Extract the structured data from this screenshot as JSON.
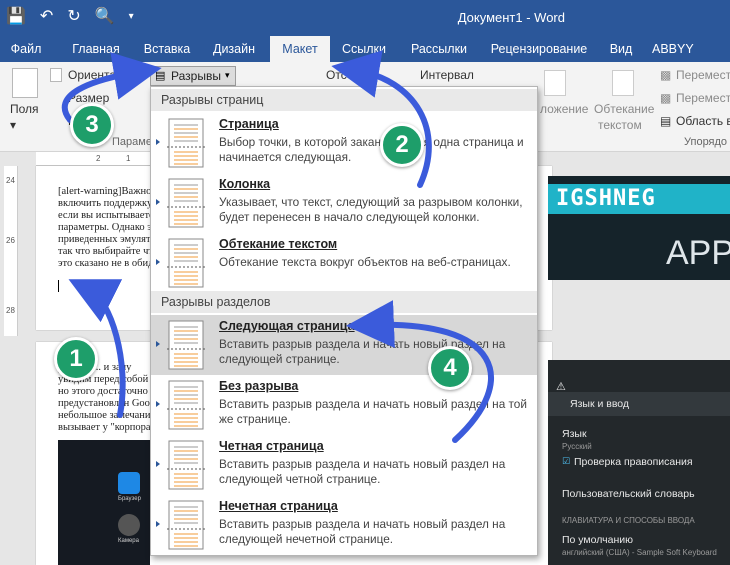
{
  "window": {
    "title": "Документ1 - Word"
  },
  "tabs": [
    "Файл",
    "Главная",
    "Вставка",
    "Дизайн",
    "Макет",
    "Ссылки",
    "Рассылки",
    "Рецензирование",
    "Вид",
    "ABBYY FineRe"
  ],
  "ribbon": {
    "fields_label": "Поля",
    "orientation_label": "Ориентация",
    "size_label": "Размер",
    "columns_label": "Ко",
    "breaks_label": "Разрывы",
    "indent_label": "Отс",
    "interval_label": "Интервал",
    "page_setup_group": "Параметры",
    "position_label": "ложение",
    "wrap_text_label": "Обтекание",
    "wrap_text_label2": "текстом",
    "move_forward": "Перемест",
    "move_backward": "Перемест",
    "selection_pane": "Область в",
    "arrange_group": "Упорядо"
  },
  "ruler": {
    "h_marks": [
      "2",
      "1"
    ],
    "v_marks": [
      "24",
      "26",
      "28",
      "2"
    ]
  },
  "document": {
    "page1_lines": [
      "[alert-warning]Важное",
      "включить поддержку в",
      "если вы испытываете",
      "параметры. Однако эт",
      "приведенных эмулято",
      "так что выбирайте что",
      "это сказано не в обиду"
    ],
    "page2_lines": [
      "установ... и запу",
      "увидим перед собой",
      "но этого достаточно д",
      "предустановлен Googl",
      "небольшое замечание",
      "вызывает у \"корпорац"
    ]
  },
  "images": {
    "banner_title": "IGSHNEG",
    "banner_sub": "APP",
    "emulator_labels": [
      "Браузер",
      "Камера"
    ],
    "settings_header": "Язык и ввод",
    "settings_lang": "Язык",
    "settings_lang_value": "Русский",
    "settings_spell": "Проверка правописания",
    "settings_dict": "Пользовательский словарь",
    "settings_section": "КЛАВИАТУРА И СПОСОБЫ ВВОДА",
    "settings_default": "По умолчанию",
    "settings_default_value": "английский (США) - Sample Soft Keyboard"
  },
  "dropdown": {
    "section_page_breaks": "Разрывы страниц",
    "section_section_breaks": "Разрывы разделов",
    "items": [
      {
        "title": "Страница",
        "desc": "Выбор точки, в которой заканчивается одна страница и начинается следующая."
      },
      {
        "title": "Колонка",
        "desc": "Указывает, что текст, следующий за разрывом колонки, будет перенесен в начало следующей колонки."
      },
      {
        "title": "Обтекание текстом",
        "desc": "Обтекание текста вокруг объектов на веб-страницах."
      },
      {
        "title": "Следующая страница",
        "desc": "Вставить разрыв раздела и начать новый раздел на следующей странице."
      },
      {
        "title": "Без разрыва",
        "desc": "Вставить разрыв раздела и начать новый раздел на той же странице."
      },
      {
        "title": "Четная страница",
        "desc": "Вставить разрыв раздела и начать новый раздел на следующей четной странице."
      },
      {
        "title": "Нечетная страница",
        "desc": "Вставить разрыв раздела и начать новый раздел на следующей нечетной странице."
      }
    ]
  },
  "annotations": [
    "1",
    "2",
    "3",
    "4"
  ],
  "colors": {
    "title_bar": "#2b579a",
    "badge": "#1e9e6a",
    "arrow": "#3b5bdb"
  }
}
